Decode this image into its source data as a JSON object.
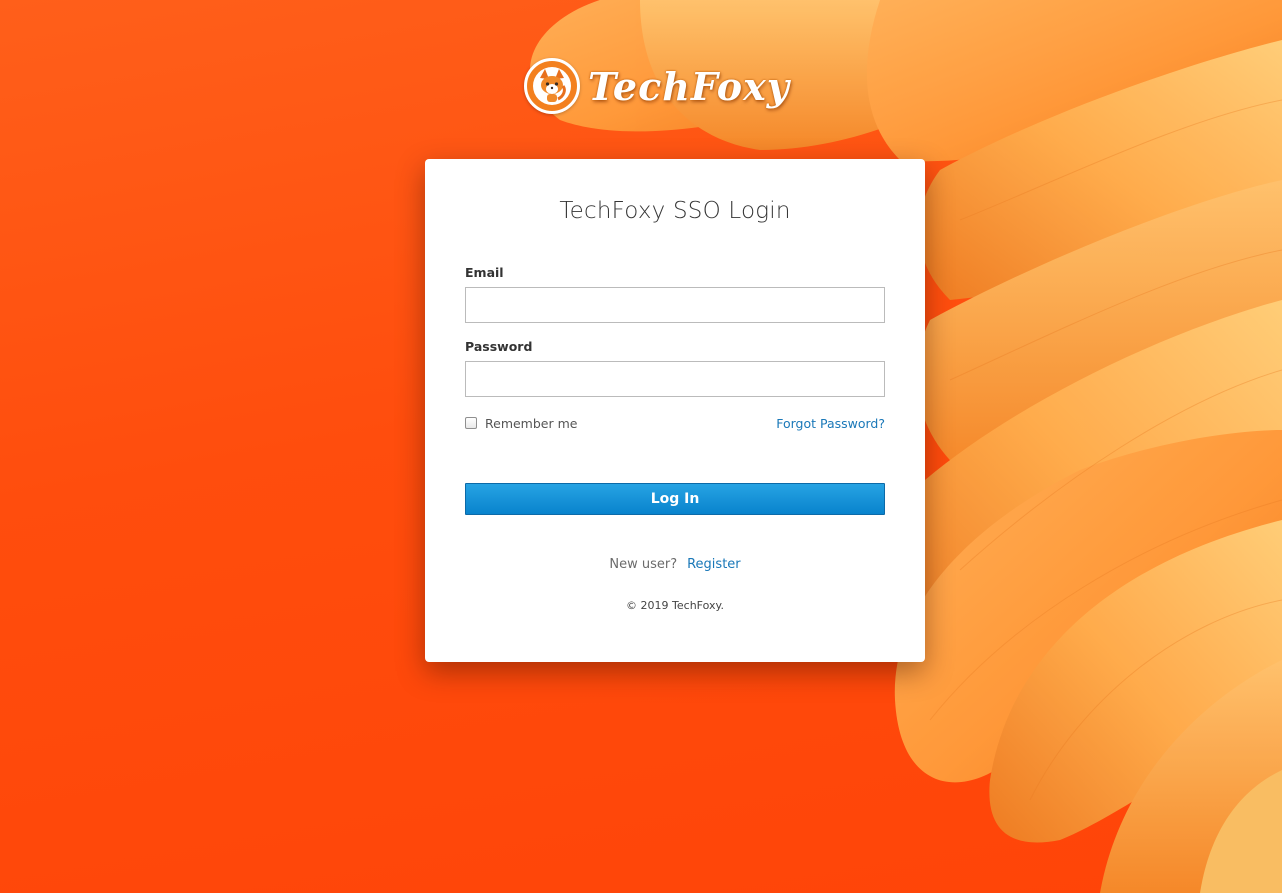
{
  "brand": {
    "name": "TechFoxy",
    "logo_icon": "fox-icon",
    "colors": {
      "background": "#ff4d0d",
      "accent_button": "#0f8fd6",
      "link": "#1a78b8"
    }
  },
  "login": {
    "title": "TechFoxy SSO Login",
    "email_label": "Email",
    "email_value": "",
    "password_label": "Password",
    "password_value": "",
    "remember_label": "Remember me",
    "remember_checked": false,
    "forgot_label": "Forgot Password?",
    "submit_label": "Log In",
    "new_user_text": "New user?",
    "register_label": "Register",
    "copyright": "© 2019 TechFoxy."
  }
}
